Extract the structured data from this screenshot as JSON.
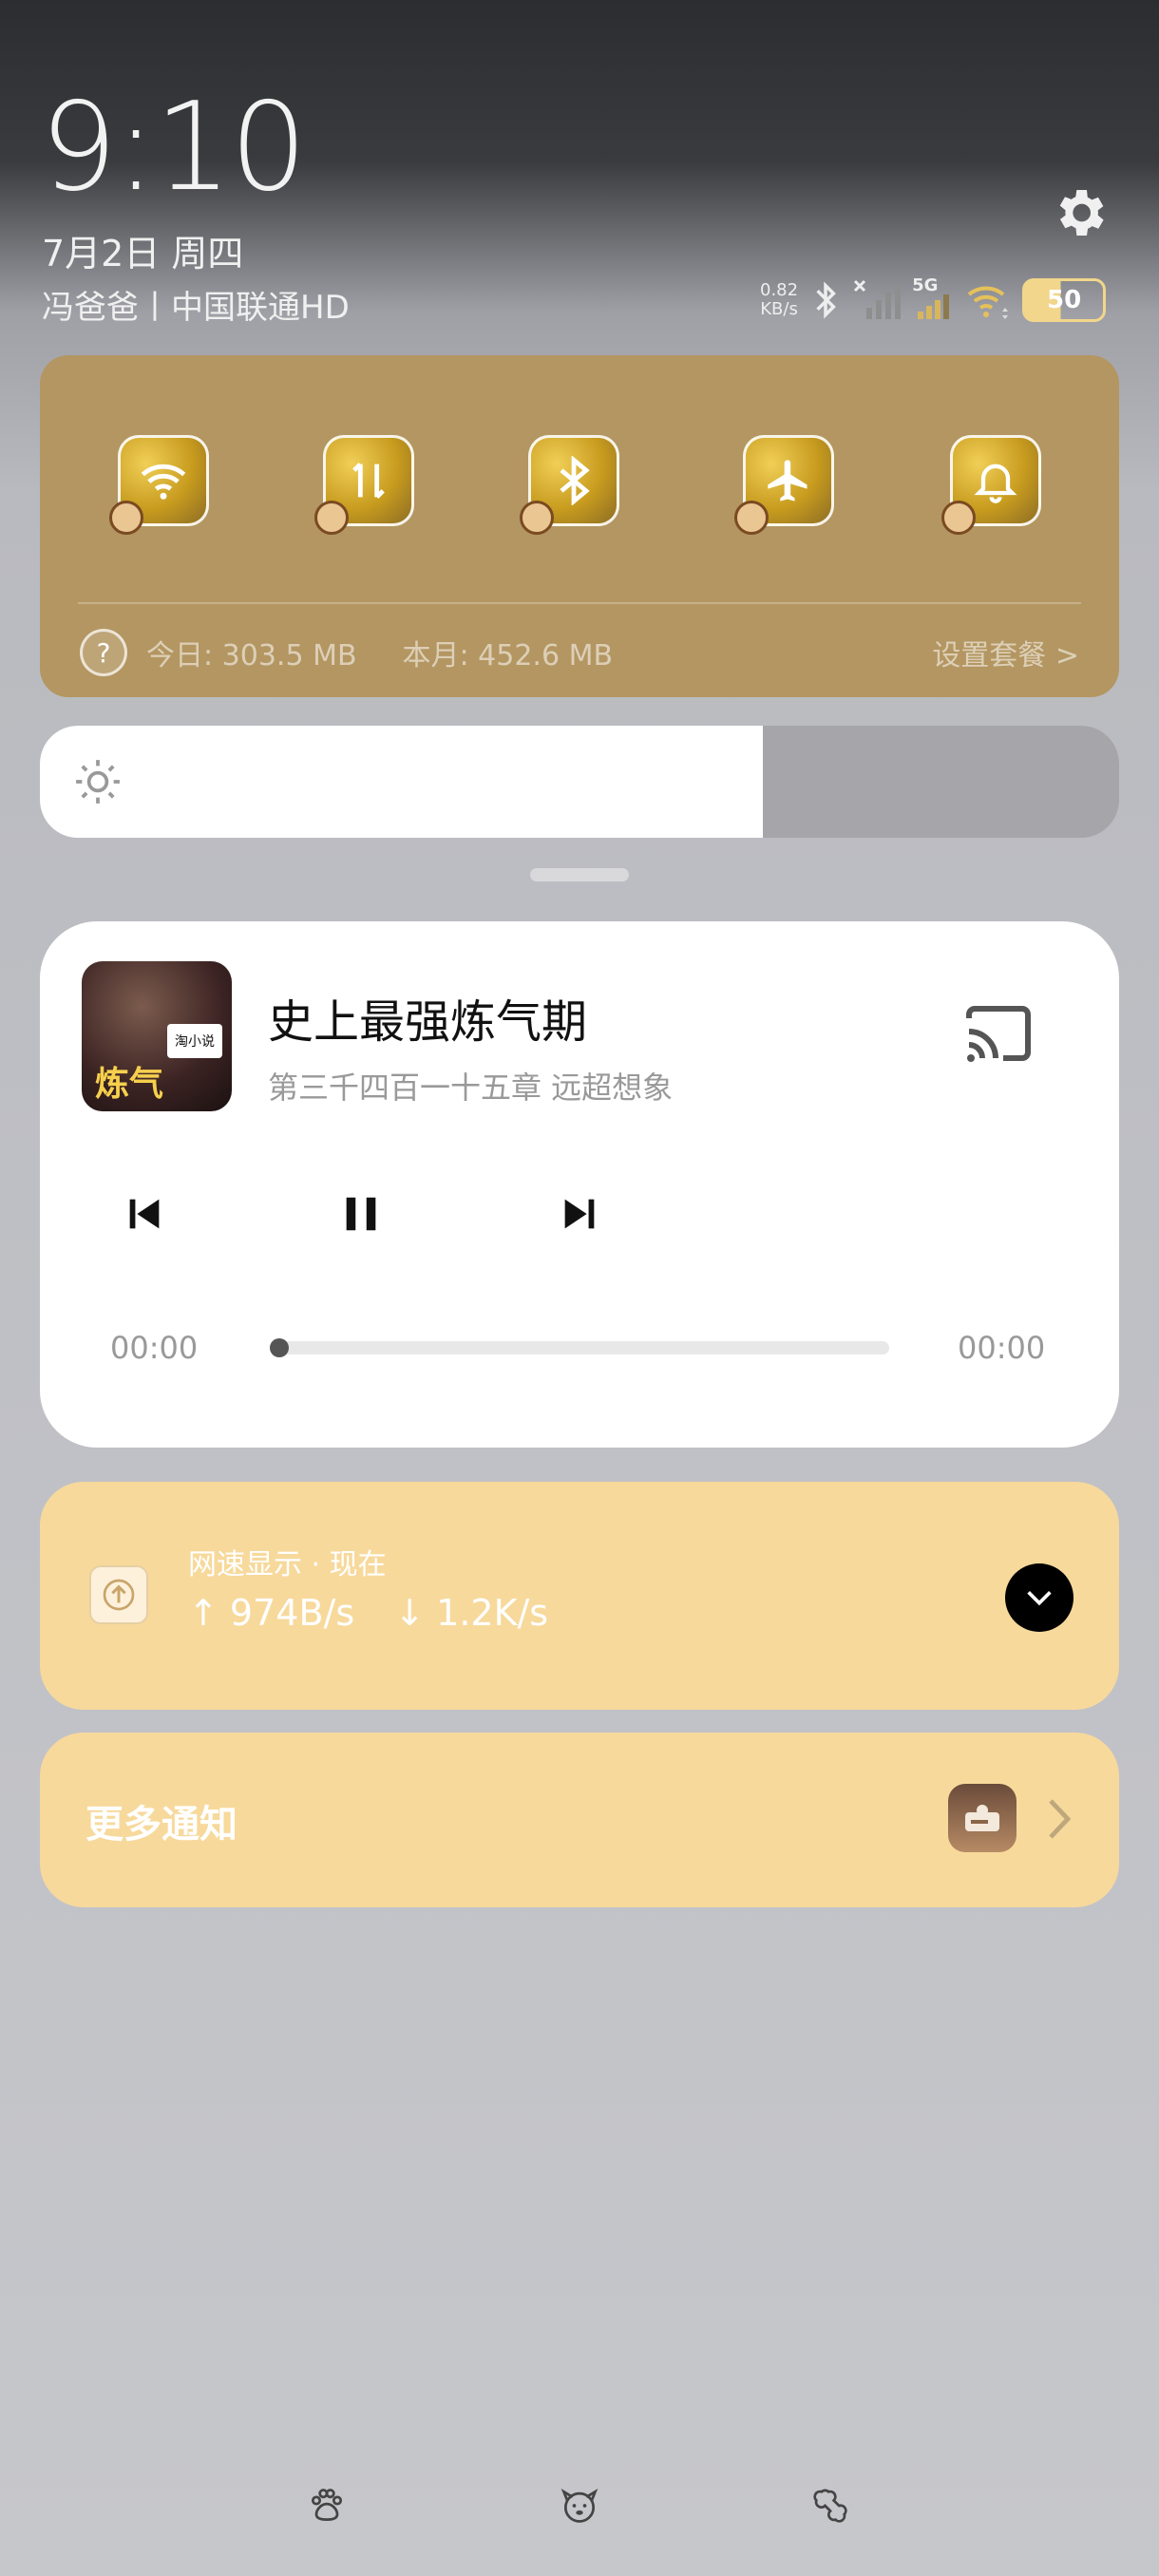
{
  "status": {
    "time": "9:10",
    "date": "7月2日 周四",
    "carrier": "冯爸爸丨中国联通HD",
    "net_speed_value": "0.82",
    "net_speed_unit": "KB/s",
    "network_label": "5G",
    "battery": "50"
  },
  "toggles": [
    {
      "name": "wifi",
      "icon": "wifi-icon"
    },
    {
      "name": "mobile-data",
      "icon": "data-transfer-icon"
    },
    {
      "name": "bluetooth",
      "icon": "bluetooth-icon"
    },
    {
      "name": "airplane-mode",
      "icon": "airplane-icon"
    },
    {
      "name": "ringer",
      "icon": "bell-icon"
    }
  ],
  "data_usage": {
    "today": "今日: 303.5 MB",
    "month": "本月: 452.6 MB",
    "settings": "设置套餐 >"
  },
  "brightness": {
    "level": 0.67
  },
  "media": {
    "title": "史上最强炼气期",
    "subtitle": "第三千四百一十五章 远超想象",
    "elapsed": "00:00",
    "duration": "00:00",
    "progress": 0,
    "cover_text_main": "炼气",
    "cover_text_tag": "淘小说"
  },
  "netspeed_notification": {
    "app": "网速显示 · 现在",
    "up": "↑ 974B/s",
    "down": "↓ 1.2K/s"
  },
  "more_notifications": {
    "label": "更多通知"
  },
  "colors": {
    "toggle_panel": "#b39661",
    "notification_card": "#f7d99c",
    "media_card": "#ffffff"
  }
}
